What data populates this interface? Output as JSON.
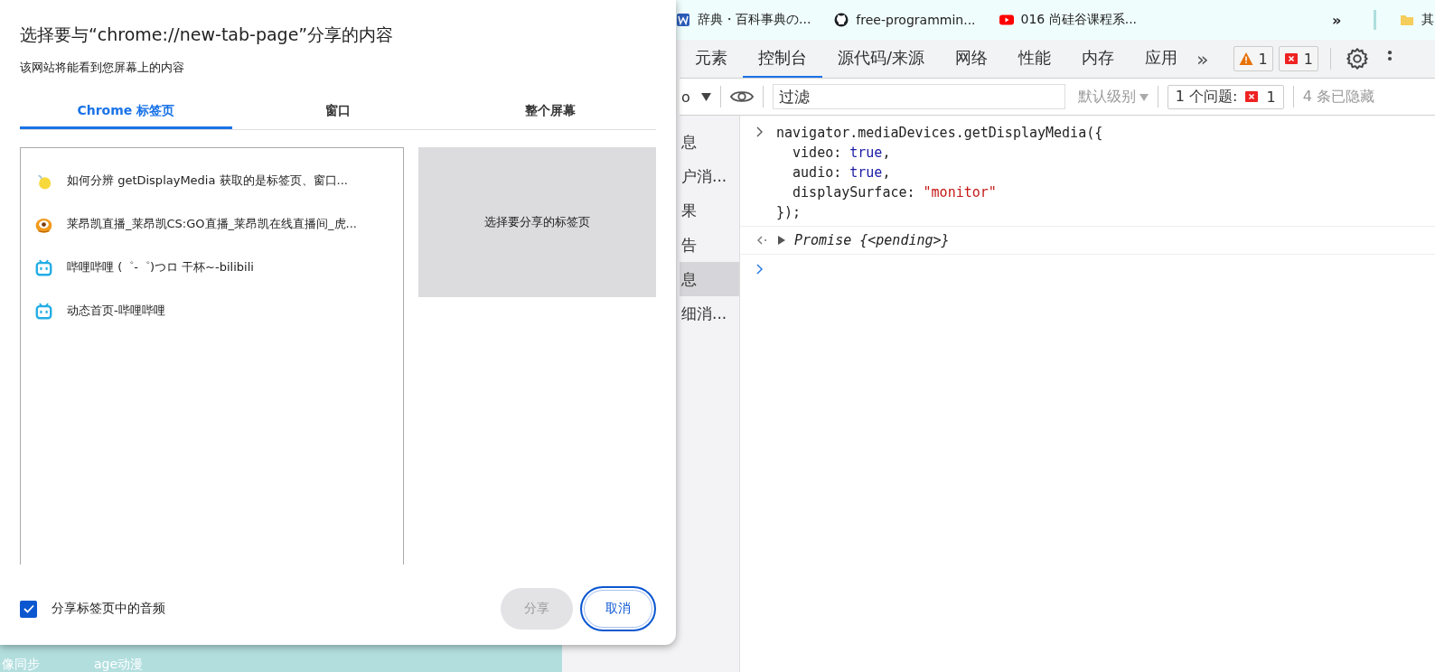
{
  "bookmarks": [
    {
      "kind": "word",
      "label": "辞典・百科事典の..."
    },
    {
      "kind": "github",
      "label": "free-programmin..."
    },
    {
      "kind": "youtube",
      "label": "016 尚硅谷课程系..."
    }
  ],
  "bookmarks_more": "»",
  "bookmark_folder": "其",
  "page_links": [
    "像同步",
    "age动漫"
  ],
  "devtools": {
    "tabs": [
      {
        "label": "元素",
        "selected": false
      },
      {
        "label": "控制台",
        "selected": true
      },
      {
        "label": "源代码/来源",
        "selected": false
      },
      {
        "label": "网络",
        "selected": false
      },
      {
        "label": "性能",
        "selected": false
      },
      {
        "label": "内存",
        "selected": false
      },
      {
        "label": "应用",
        "selected": false
      }
    ],
    "more_tabs": "»",
    "warning_count": "1",
    "error_count": "1",
    "context": "o",
    "filter_placeholder": "过滤",
    "levels": "默认级别",
    "issues_label": "1 个问题:",
    "issues_count": "1",
    "hidden": "4 条已隐藏",
    "sidebar": [
      {
        "label": "息",
        "selected": false
      },
      {
        "label": "户消...",
        "selected": false
      },
      {
        "label": "果",
        "selected": false
      },
      {
        "label": "告",
        "selected": false
      },
      {
        "label": "息",
        "selected": true
      },
      {
        "label": "细消...",
        "selected": false
      }
    ],
    "console": {
      "input": [
        "navigator.mediaDevices.getDisplayMedia({",
        "  video: true,",
        "  audio: true,",
        "  displaySurface: \"monitor\"",
        "});"
      ],
      "result": "Promise {<pending>}"
    }
  },
  "dialog": {
    "title": "选择要与“chrome://new-tab-page”分享的内容",
    "subtitle": "该网站将能看到您屏幕上的内容",
    "tabs": [
      {
        "label": "Chrome 标签页",
        "selected": true
      },
      {
        "label": "窗口",
        "selected": false
      },
      {
        "label": "整个屏幕",
        "selected": false
      }
    ],
    "items": [
      {
        "kind": "lemon",
        "title": "如何分辨 getDisplayMedia 获取的是标签页、窗口..."
      },
      {
        "kind": "huya",
        "title": "莱昂凯直播_莱昂凯CS:GO直播_莱昂凯在线直播间_虎..."
      },
      {
        "kind": "bilibili",
        "title": "哔哩哔哩 (゜-゜)つロ 干杯~-bilibili"
      },
      {
        "kind": "bilibili",
        "title": "动态首页-哔哩哔哩"
      }
    ],
    "preview": "选择要分享的标签页",
    "audio": {
      "label": "分享标签页中的音频",
      "checked": true
    },
    "share": {
      "label": "分享",
      "disabled": true
    },
    "cancel": "取消"
  }
}
